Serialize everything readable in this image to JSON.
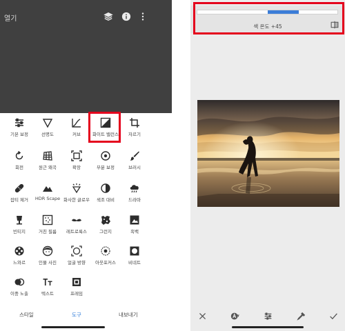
{
  "left_screen": {
    "header": {
      "open_label": "열기",
      "icons": [
        "layers-icon",
        "info-icon",
        "more-vertical-icon"
      ]
    },
    "tools": [
      {
        "label": "기본 보정",
        "icon": "tune-icon"
      },
      {
        "label": "선명도",
        "icon": "details-icon"
      },
      {
        "label": "커브",
        "icon": "curves-icon"
      },
      {
        "label": "화이트 밸런스",
        "icon": "white-balance-icon",
        "highlighted": true
      },
      {
        "label": "자르기",
        "icon": "crop-icon"
      },
      {
        "label": "회전",
        "icon": "rotate-icon"
      },
      {
        "label": "원근 왜곡",
        "icon": "perspective-icon"
      },
      {
        "label": "확장",
        "icon": "expand-icon"
      },
      {
        "label": "부분 보정",
        "icon": "selective-icon"
      },
      {
        "label": "브러시",
        "icon": "brush-icon"
      },
      {
        "label": "잡티 제거",
        "icon": "healing-icon"
      },
      {
        "label": "HDR Scape",
        "icon": "hdr-icon"
      },
      {
        "label": "화사한 글로우",
        "icon": "glamour-glow-icon"
      },
      {
        "label": "색조 대비",
        "icon": "tonal-contrast-icon"
      },
      {
        "label": "드라마",
        "icon": "drama-icon"
      },
      {
        "label": "빈티지",
        "icon": "vintage-icon"
      },
      {
        "label": "거친 필름",
        "icon": "grainy-film-icon"
      },
      {
        "label": "레트로룩스",
        "icon": "retrolux-icon"
      },
      {
        "label": "그런지",
        "icon": "grunge-icon"
      },
      {
        "label": "흑백",
        "icon": "black-white-icon"
      },
      {
        "label": "느와르",
        "icon": "noir-icon"
      },
      {
        "label": "인물 사진",
        "icon": "portrait-icon"
      },
      {
        "label": "얼굴 방향",
        "icon": "head-pose-icon"
      },
      {
        "label": "아웃포커스",
        "icon": "lens-blur-icon"
      },
      {
        "label": "비네트",
        "icon": "vignette-icon"
      },
      {
        "label": "이중 노출",
        "icon": "double-exposure-icon"
      },
      {
        "label": "텍스트",
        "icon": "text-icon"
      },
      {
        "label": "프레임",
        "icon": "frames-icon"
      }
    ],
    "bottom_nav": {
      "styles": "스타일",
      "tools": "도구",
      "export": "내보내기",
      "active": "tools"
    },
    "highlight_color": "#e4001c",
    "accent_color": "#2f7bd8"
  },
  "right_screen": {
    "adjustment": {
      "label": "색 온도 +45",
      "value": 45,
      "min": -100,
      "max": 100
    },
    "bottom_toolbar": {
      "icons": [
        "close-icon",
        "auto-icon",
        "tune-icon",
        "eyedropper-icon",
        "check-icon"
      ]
    },
    "photo": "couple-at-sunset-beach",
    "highlight_color": "#e4001c",
    "slider_color": "#3b7dd8"
  }
}
